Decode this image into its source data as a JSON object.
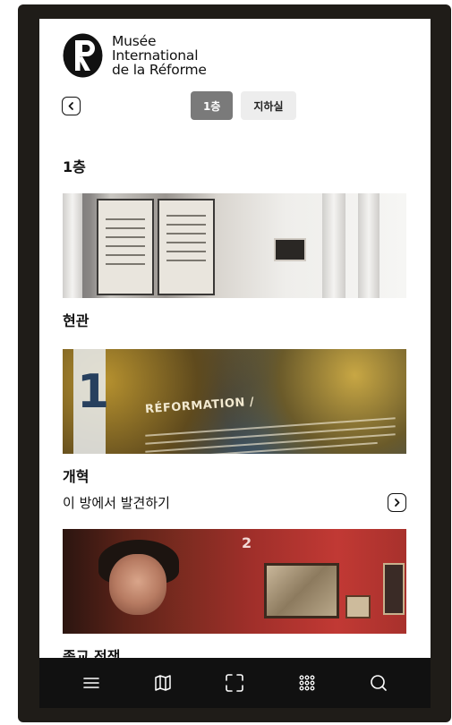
{
  "museum": {
    "name_lines": [
      "Musée",
      "International",
      "de la Réforme"
    ]
  },
  "floor_tabs": [
    {
      "label": "1층",
      "active": true
    },
    {
      "label": "지하실",
      "active": false
    }
  ],
  "floor_heading": "1층",
  "rooms": [
    {
      "title": "현관",
      "discover": null
    },
    {
      "title": "개혁",
      "discover": "이 방에서 발견하기"
    },
    {
      "title": "종교 전쟁",
      "discover": null
    }
  ],
  "image_text": {
    "reformation_title": "RÉFORMATION /",
    "room_number_1": "1",
    "room_number_2": "2"
  },
  "bottom_nav": [
    {
      "icon": "menu-icon"
    },
    {
      "icon": "map-icon"
    },
    {
      "icon": "scan-icon"
    },
    {
      "icon": "grid-icon"
    },
    {
      "icon": "search-icon"
    }
  ],
  "colors": {
    "active_tab": "#7a7a7a",
    "inactive_tab": "#ededed",
    "bottom_nav": "#111111"
  }
}
